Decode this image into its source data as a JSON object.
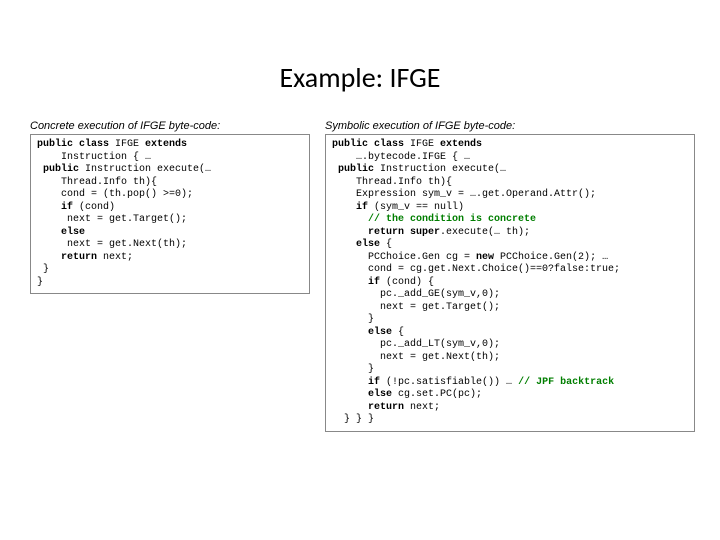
{
  "title": "Example: IFGE",
  "left": {
    "caption": "Concrete execution of IFGE byte-code:",
    "code_html": "<span class=\"kw\">public class</span> IFGE <span class=\"kw\">extends</span>\n    Instruction { …\n <span class=\"kw\">public</span> Instruction execute(…\n    Thread.Info th){\n    cond = (th.pop() >=0);\n    <span class=\"kw\">if</span> (cond)\n     next = get.Target();\n    <span class=\"kw\">else</span>\n     next = get.Next(th);\n    <span class=\"kw\">return</span> next;\n }\n}"
  },
  "right": {
    "caption": "Symbolic execution of IFGE byte-code:",
    "code_html": "<span class=\"kw\">public class</span> IFGE <span class=\"kw\">extends</span>\n    ….bytecode.IFGE { …\n <span class=\"kw\">public</span> Instruction execute(…\n    Thread.Info th){\n    Expression sym_v = ….get.Operand.Attr();\n    <span class=\"kw\">if</span> (sym_v == null)\n      <span class=\"cm\">// the condition is concrete</span>\n      <span class=\"kw\">return super</span>.execute(… th);\n    <span class=\"kw\">else</span> {\n      PCChoice.Gen cg = <span class=\"kw\">new</span> PCChoice.Gen(2); …\n      cond = cg.get.Next.Choice()==0?false:true;\n      <span class=\"kw\">if</span> (cond) {\n        pc._add_GE(sym_v,0);\n        next = get.Target();\n      }\n      <span class=\"kw\">else</span> {\n        pc._add_LT(sym_v,0);\n        next = get.Next(th);\n      }\n      <span class=\"kw\">if</span> (!pc.satisfiable()) … <span class=\"cm\">// JPF backtrack</span>\n      <span class=\"kw\">else</span> cg.set.PC(pc);\n      <span class=\"kw\">return</span> next;\n  } } }"
  }
}
